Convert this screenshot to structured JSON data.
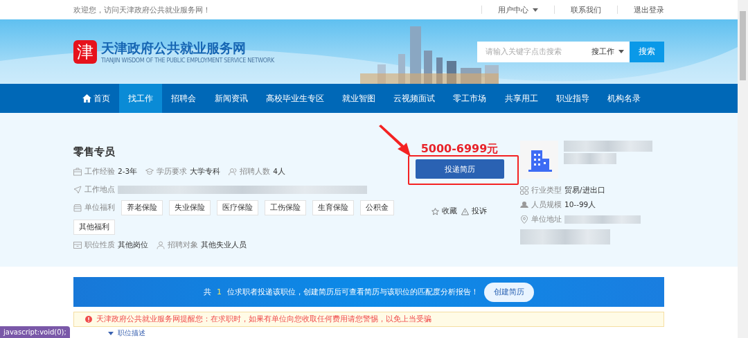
{
  "top_bar": {
    "welcome": "欢迎您，访问天津政府公共就业服务网！",
    "links": [
      {
        "label": "用户中心",
        "dropdown": true
      },
      {
        "label": "联系我们",
        "dropdown": false
      },
      {
        "label": "退出登录",
        "dropdown": false
      }
    ]
  },
  "header": {
    "logo_char": "津",
    "site_name": "天津政府公共就业服务网",
    "site_name_en": "TIANJIN WISDOM OF THE PUBLIC EMPLOYMENT SERVICE NETWORK",
    "search": {
      "placeholder": "请输入关键字点击搜索",
      "type": "搜工作",
      "button": "搜索"
    }
  },
  "nav": [
    {
      "label": "首页",
      "selected": false,
      "kind": "home"
    },
    {
      "label": "找工作",
      "selected": true,
      "kind": "text"
    },
    {
      "label": "招聘会",
      "selected": false,
      "kind": "text"
    },
    {
      "label": "新闻资讯",
      "selected": false,
      "kind": "text"
    },
    {
      "label": "高校毕业生专区",
      "selected": false,
      "kind": "text"
    },
    {
      "label": "就业智图",
      "selected": false,
      "kind": "text"
    },
    {
      "label": "云视频面试",
      "selected": false,
      "kind": "text"
    },
    {
      "label": "零工市场",
      "selected": false,
      "kind": "text"
    },
    {
      "label": "共享用工",
      "selected": false,
      "kind": "text"
    },
    {
      "label": "职业指导",
      "selected": false,
      "kind": "text"
    },
    {
      "label": "机构名录",
      "selected": false,
      "kind": "text"
    }
  ],
  "job": {
    "title": "零售专员",
    "facts": [
      {
        "label": "工作经验",
        "value": "2-3年",
        "kind": "briefcase"
      },
      {
        "label": "学历要求",
        "value": "大学专科",
        "kind": "cap"
      },
      {
        "label": "招聘人数",
        "value": "4人",
        "kind": "people"
      }
    ],
    "location_label": "工作地点",
    "welfare_label": "单位福利",
    "welfare": [
      "养老保险",
      "失业保险",
      "医疗保险",
      "工伤保险",
      "生育保险",
      "公积金",
      "其他福利"
    ],
    "more_facts": [
      {
        "label": "职位性质",
        "value": "其他岗位",
        "kind": "box"
      },
      {
        "label": "招聘对象",
        "value": "其他失业人员",
        "kind": "person"
      }
    ],
    "salary": "5000-6999元",
    "apply_button": "投递简历",
    "actions": [
      {
        "label": "收藏",
        "kind": "star"
      },
      {
        "label": "投诉",
        "kind": "warning"
      }
    ]
  },
  "company": {
    "facts": [
      {
        "label": "行业类型",
        "value": "贸易/进出口",
        "kind": "grid"
      },
      {
        "label": "人员规模",
        "value": "10--99人",
        "kind": "people"
      },
      {
        "label": "单位地址",
        "kind": "pin"
      }
    ]
  },
  "promo": {
    "prefix": "共",
    "count": "1",
    "suffix": "位求职者投递该职位，创建简历后可查看简历与该职位的匹配度分析报告！",
    "button": "创建简历"
  },
  "notice": "天津政府公共就业服务网提醒您：在求职时，如果有单位向您收取任何费用请您警惕，以免上当受骗",
  "section_title": "职位描述",
  "status_url": "javascript:void(0);"
}
